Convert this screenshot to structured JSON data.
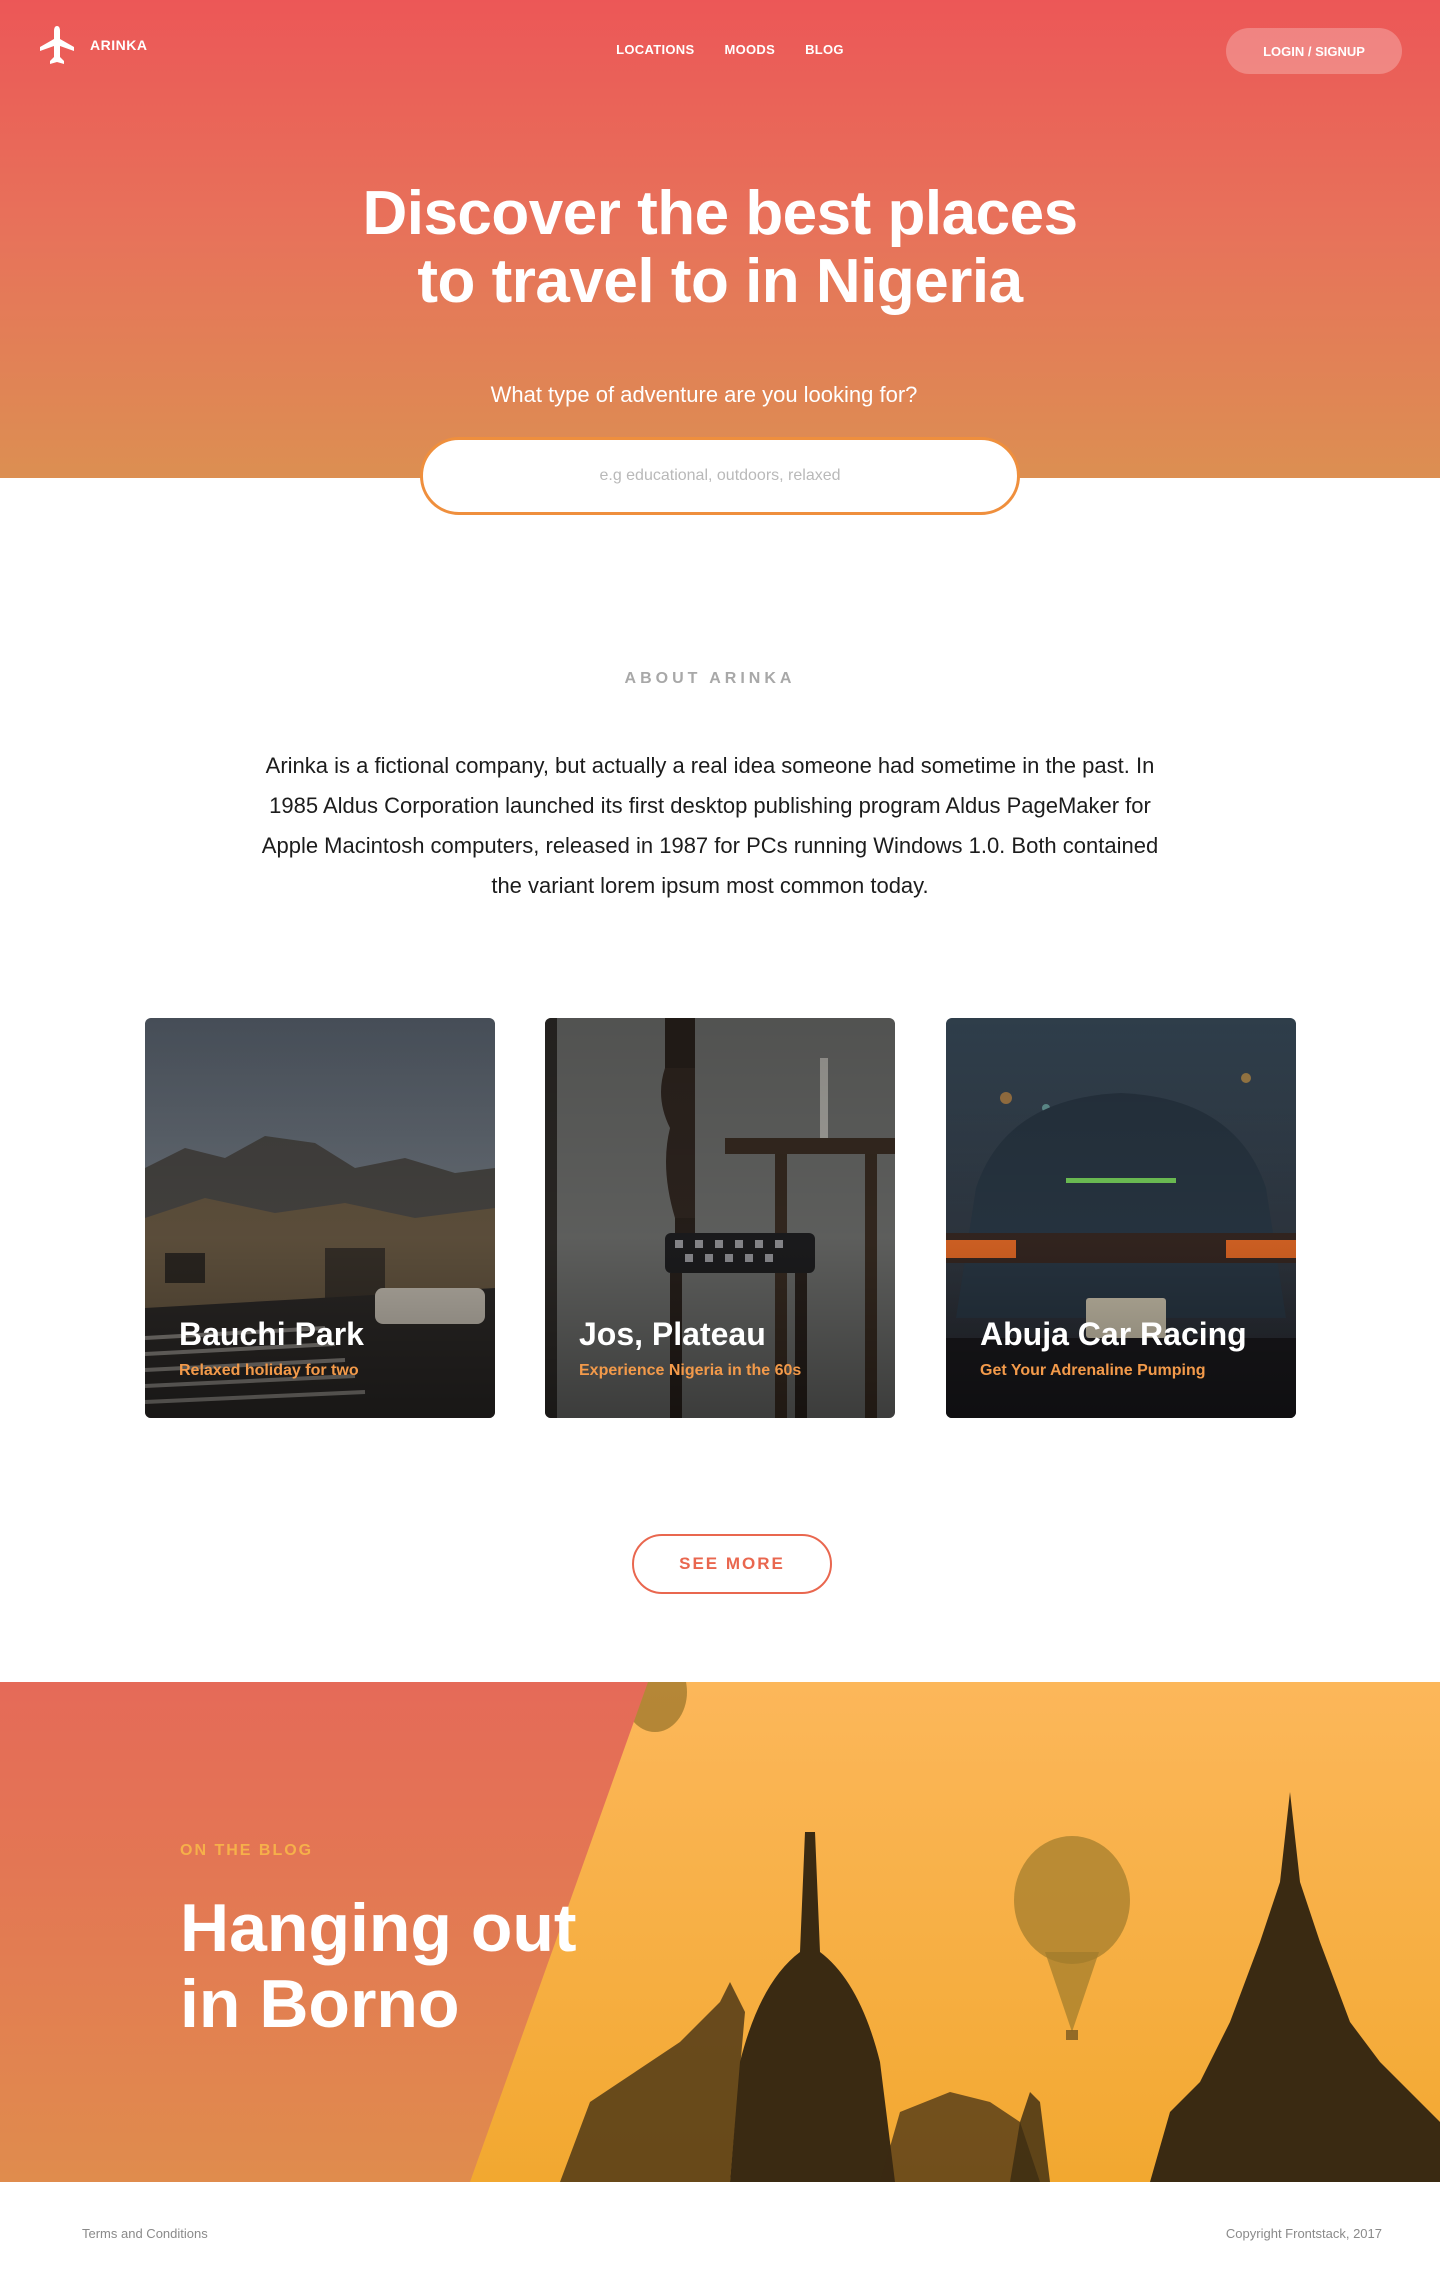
{
  "nav": {
    "brand": "ARINKA",
    "logo_icon": "airplane-icon",
    "links": [
      "LOCATIONS",
      "MOODS",
      "BLOG"
    ],
    "login_label": "LOGIN / SIGNUP"
  },
  "hero": {
    "title_line1": "Discover the best places",
    "title_line2": "to travel to in Nigeria",
    "subtitle": "What type of adventure are you looking for?",
    "search_placeholder": "e.g educational, outdoors, relaxed",
    "search_value": ""
  },
  "about": {
    "label": "ABOUT ARINKA",
    "text": "Arinka is a fictional company, but actually a real idea someone had sometime in the past. In 1985 Aldus Corporation launched its first desktop publishing program Aldus PageMaker for Apple Macintosh computers, released in 1987 for PCs running Windows 1.0. Both contained the variant lorem ipsum most common today."
  },
  "cards": [
    {
      "title": "Bauchi Park",
      "subtitle": "Relaxed holiday for two"
    },
    {
      "title": "Jos, Plateau",
      "subtitle": "Experience Nigeria in the 60s"
    },
    {
      "title": "Abuja Car Racing",
      "subtitle": "Get Your Adrenaline Pumping"
    }
  ],
  "see_more_label": "SEE MORE",
  "blog": {
    "label": "ON THE BLOG",
    "title_line1": "Hanging out",
    "title_line2": "in Borno"
  },
  "footer": {
    "terms": "Terms and Conditions",
    "copyright": "Copyright Frontstack, 2017"
  },
  "colors": {
    "hero_top": "#ec5757",
    "hero_bottom": "#dc8f52",
    "accent_orange": "#f39a4a",
    "button_red": "#e9674f"
  }
}
